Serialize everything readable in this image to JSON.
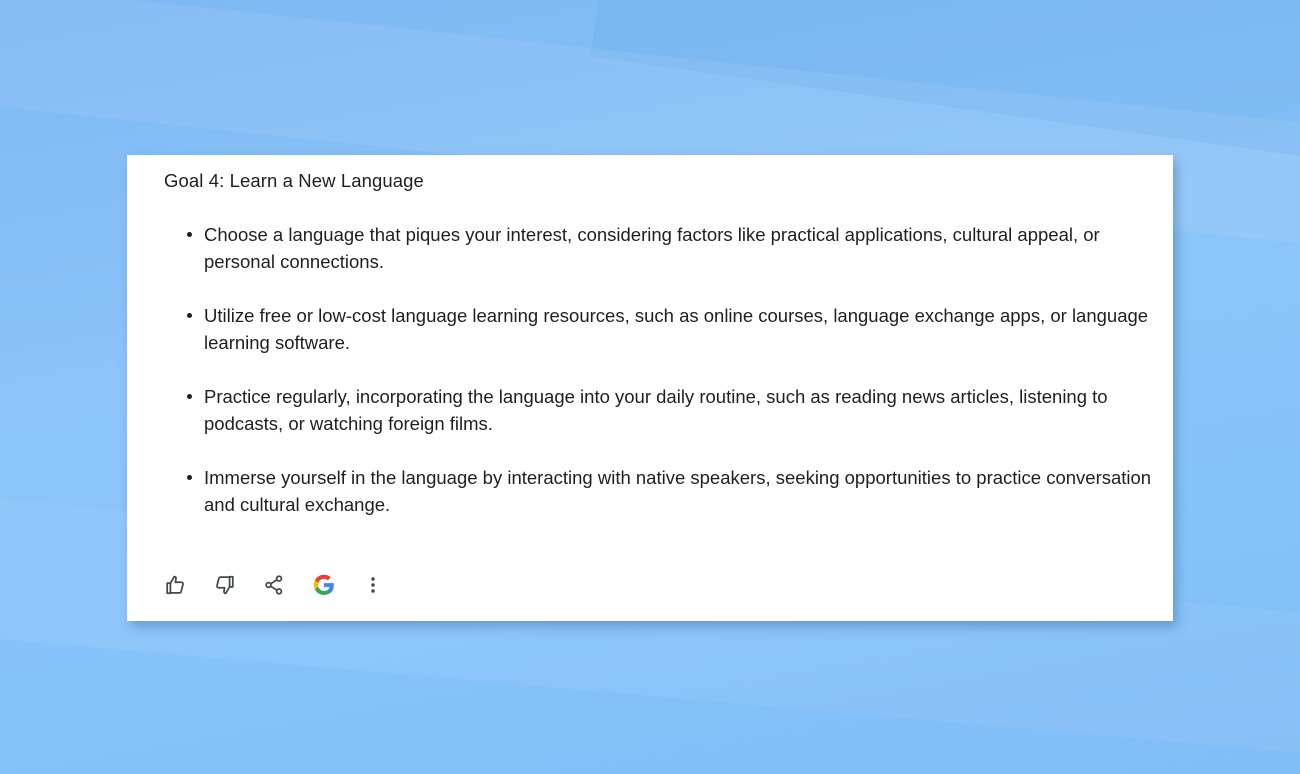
{
  "response_card": {
    "title": "Goal 4: Learn a New Language",
    "bullets": [
      "Choose a language that piques your interest, considering factors like practical applications, cultural appeal, or personal connections.",
      "Utilize free or low-cost language learning resources, such as online courses, language exchange apps, or language learning software.",
      "Practice regularly, incorporating the language into your daily routine, such as reading news articles, listening to podcasts, or watching foreign films.",
      "Immerse yourself in the language by interacting with native speakers, seeking opportunities to practice conversation and cultural exchange."
    ]
  },
  "actions": [
    {
      "icon": "thumbs-up-icon"
    },
    {
      "icon": "thumbs-down-icon"
    },
    {
      "icon": "share-icon"
    },
    {
      "icon": "google-g-icon"
    },
    {
      "icon": "more-vert-icon"
    }
  ],
  "colors": {
    "background": "#86c3fa",
    "card": "#ffffff",
    "text": "#1f1f1f",
    "icon": "#444746",
    "google_blue": "#4285F4",
    "google_red": "#EA4335",
    "google_yellow": "#FBBC05",
    "google_green": "#34A853"
  }
}
